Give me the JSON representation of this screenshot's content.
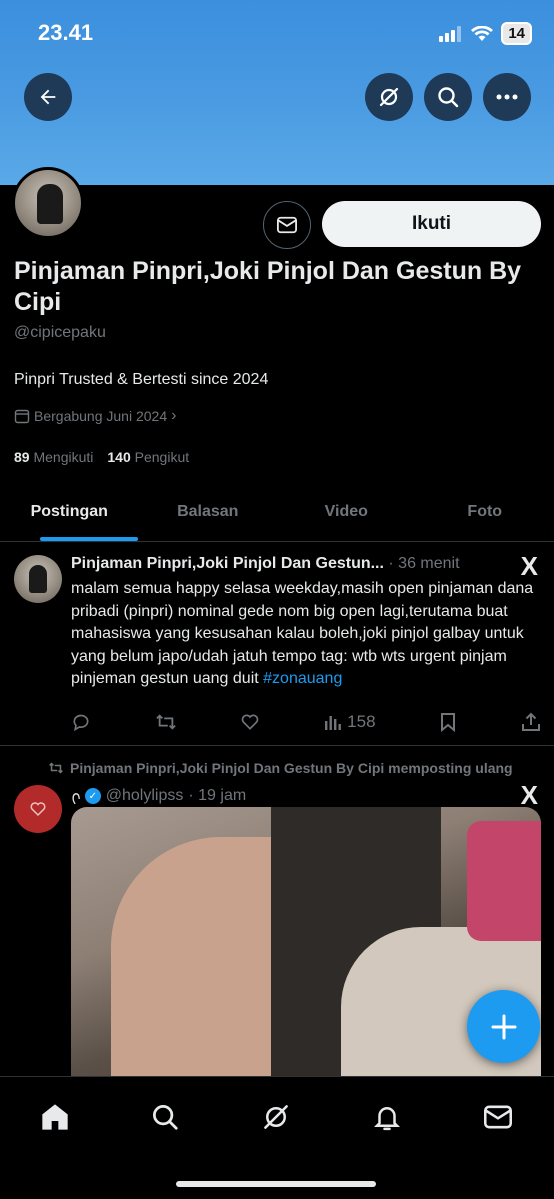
{
  "status_bar": {
    "time": "23.41",
    "battery": "14"
  },
  "profile": {
    "display_name": "Pinjaman Pinpri,Joki Pinjol Dan Gestun By Cipi",
    "handle": "@cipicepaku",
    "bio": "Pinpri Trusted & Bertesti since 2024",
    "joined": "Bergabung Juni 2024",
    "following_count": "89",
    "following_label": "Mengikuti",
    "followers_count": "140",
    "followers_label": "Pengikut",
    "follow_button": "Ikuti"
  },
  "tabs": [
    {
      "label": "Postingan",
      "active": true
    },
    {
      "label": "Balasan",
      "active": false
    },
    {
      "label": "Video",
      "active": false
    },
    {
      "label": "Foto",
      "active": false
    }
  ],
  "posts": [
    {
      "author": "Pinjaman Pinpri,Joki Pinjol Dan Gestun...",
      "time": "· 36 menit",
      "text": "malam semua happy selasa weekday,masih open pinjaman dana pribadi (pinpri) nominal gede nom big open lagi,terutama buat mahasiswa yang kesusahan kalau boleh,joki pinjol galbay untuk yang belum japo/udah jatuh tempo tag: wtb wts urgent pinjam pinjeman gestun uang duit",
      "hashtag": "#zonauang",
      "views": "158"
    }
  ],
  "repost": {
    "label": "Pinjaman Pinpri,Joki Pinjol Dan Gestun By Cipi memposting ulang",
    "handle": "@holylipss",
    "time": "· 19 jam",
    "prefix": "ᢉ"
  },
  "x_logo": "X",
  "colors": {
    "accent": "#1d9bf0",
    "banner": "#4a9be2",
    "background": "#000000"
  }
}
